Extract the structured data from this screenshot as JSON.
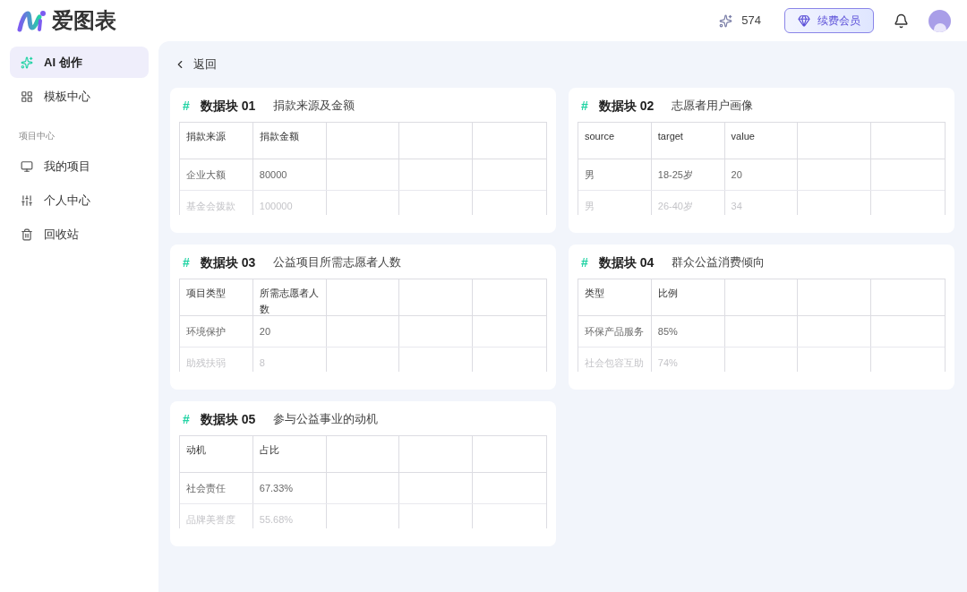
{
  "brand": {
    "name": "爱图表"
  },
  "header": {
    "credits": "574",
    "renew_button": "续费会员"
  },
  "sidebar": {
    "items": [
      {
        "label": "AI 创作",
        "selected": true
      },
      {
        "label": "模板中心",
        "selected": false
      }
    ],
    "section_title": "项目中心",
    "section_items": [
      {
        "label": "我的项目",
        "selected": false
      },
      {
        "label": "个人中心",
        "selected": false
      },
      {
        "label": "回收站",
        "selected": false
      }
    ]
  },
  "back_link": "返回",
  "blocks": [
    {
      "tag": "#",
      "name": "数据块 01",
      "title": "捐款来源及金额",
      "columns": [
        "捐款来源",
        "捐款金额"
      ],
      "rows": [
        [
          "企业大额",
          "80000"
        ],
        [
          "基金会拨款",
          "100000"
        ]
      ]
    },
    {
      "tag": "#",
      "name": "数据块 02",
      "title": "志愿者用户画像",
      "columns": [
        "source",
        "target",
        "value"
      ],
      "rows": [
        [
          "男",
          "18-25岁",
          "20"
        ],
        [
          "男",
          "26-40岁",
          "34"
        ]
      ]
    },
    {
      "tag": "#",
      "name": "数据块 03",
      "title": "公益项目所需志愿者人数",
      "columns": [
        "项目类型",
        "所需志愿者人数"
      ],
      "rows": [
        [
          "环境保护",
          "20"
        ],
        [
          "助残扶弱",
          "8"
        ]
      ]
    },
    {
      "tag": "#",
      "name": "数据块 04",
      "title": "群众公益消费倾向",
      "columns": [
        "类型",
        "比例"
      ],
      "rows": [
        [
          "环保产品服务",
          "85%"
        ],
        [
          "社会包容互助",
          "74%"
        ]
      ]
    },
    {
      "tag": "#",
      "name": "数据块 05",
      "title": "参与公益事业的动机",
      "columns": [
        "动机",
        "占比"
      ],
      "rows": [
        [
          "社会责任",
          "67.33%"
        ],
        [
          "品牌美誉度",
          "55.68%"
        ]
      ]
    }
  ]
}
